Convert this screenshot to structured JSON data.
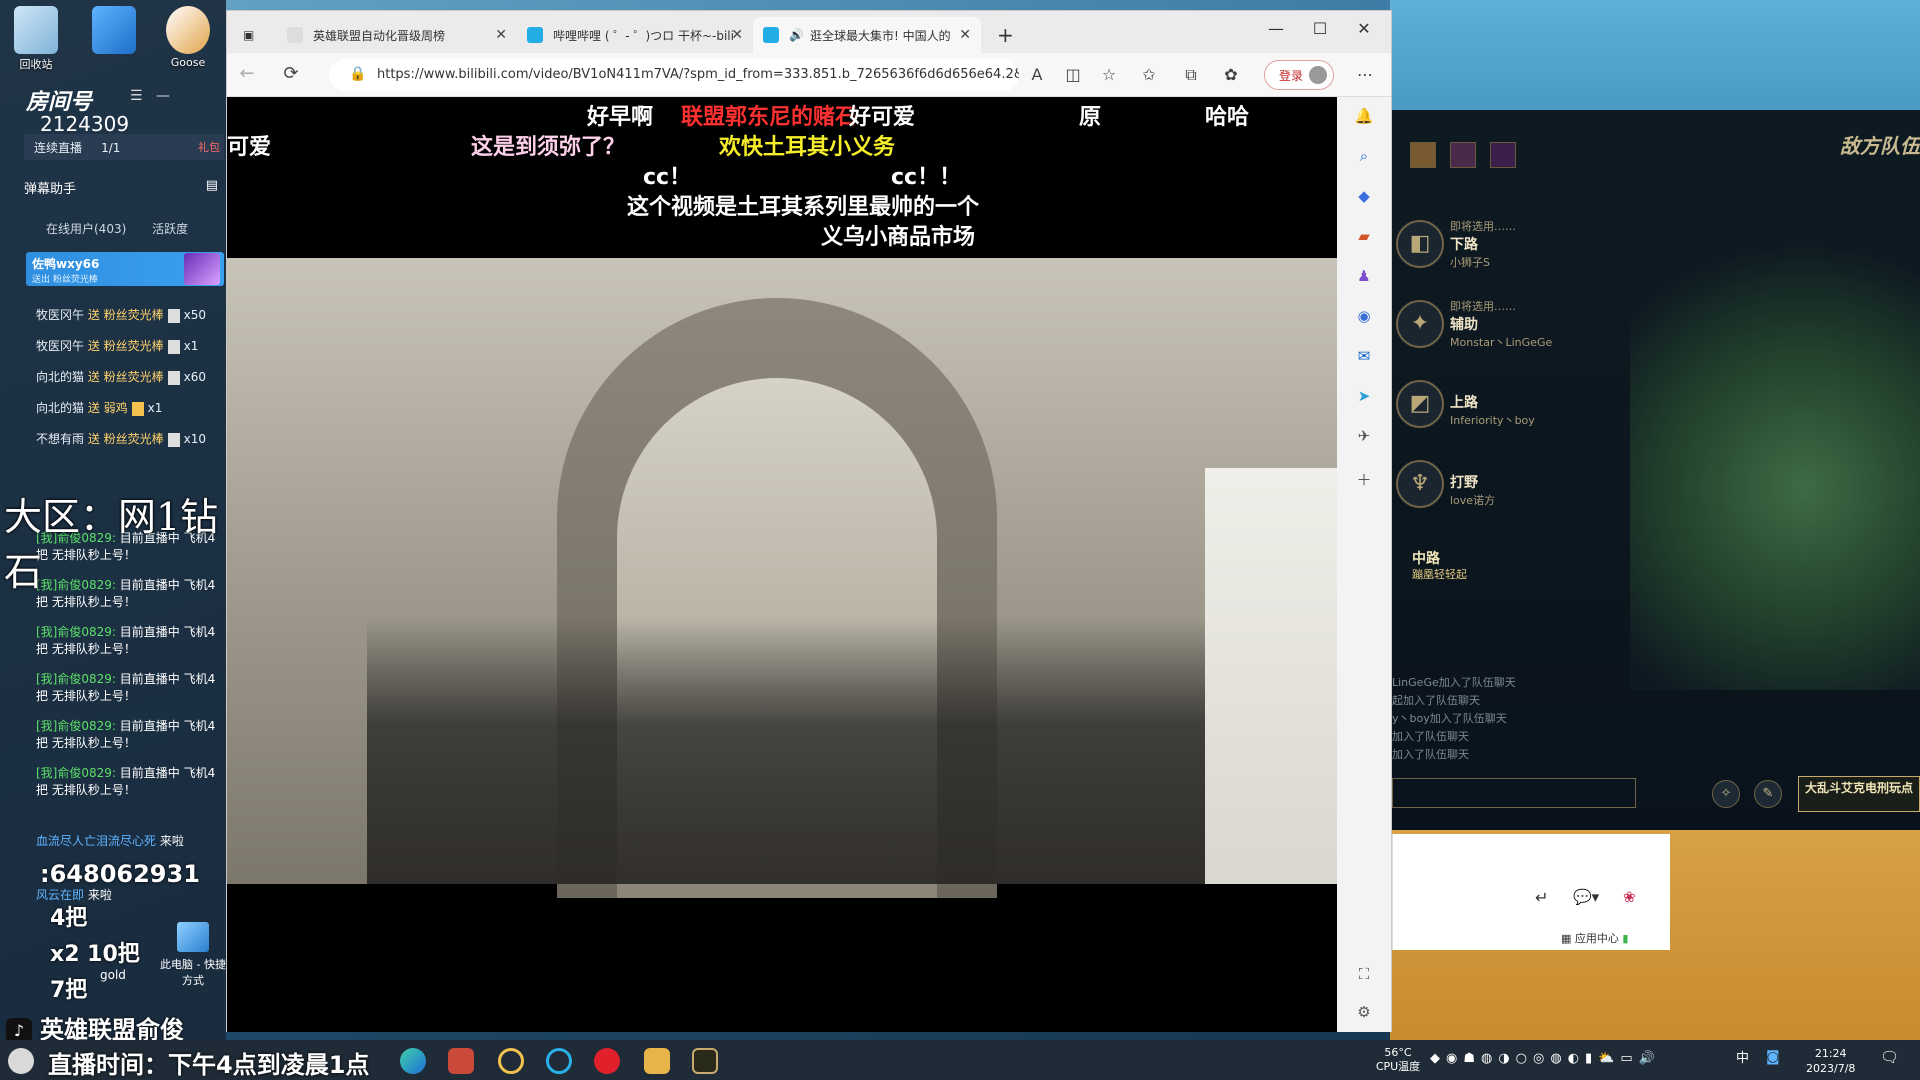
{
  "desktop": {
    "icons": [
      {
        "label": "回收站"
      },
      {
        "label": ""
      },
      {
        "label": "Goose"
      }
    ]
  },
  "stream_panel": {
    "room_label": "房间号",
    "room_id": "2124309",
    "stream_mode": "连续直播",
    "stream_count": "1/1",
    "gift_tag": "礼包",
    "assistant_title": "弹幕助手",
    "online_tab": "在线用户(403)",
    "activity_tab": "活跃度",
    "vip_user": "佐鸭wxy66",
    "vip_sub": "送出 粉丝荧光棒",
    "gifts": [
      {
        "user": "牧医冈午",
        "action": "送 粉丝荧光棒",
        "count": "x50"
      },
      {
        "user": "牧医冈午",
        "action": "送 粉丝荧光棒",
        "count": "x1"
      },
      {
        "user": "向北的猫",
        "action": "送 粉丝荧光棒",
        "count": "x60"
      },
      {
        "user": "向北的猫",
        "action": "送 弱鸡",
        "count": "x1"
      },
      {
        "user": "不想有雨",
        "action": "送 粉丝荧光棒",
        "count": "x10"
      }
    ],
    "server_label": "大区：网1钻石",
    "danmu": [
      {
        "user": "[我]俞俊0829:",
        "text": "目前直播中 飞机4把 无排队秒上号！"
      },
      {
        "user": "[我]俞俊0829:",
        "text": "目前直播中 飞机4把 无排队秒上号！"
      },
      {
        "user": "[我]俞俊0829:",
        "text": "目前直播中 飞机4把 无排队秒上号！"
      },
      {
        "user": "[我]俞俊0829:",
        "text": "目前直播中 飞机4把 无排队秒上号！"
      },
      {
        "user": "[我]俞俊0829:",
        "text": "目前直播中 飞机4把 无排队秒上号！"
      },
      {
        "user": "[我]俞俊0829:",
        "text": "目前直播中 飞机4把 无排队秒上号！"
      }
    ],
    "enter1_user": "血流尽人亡泪流尽心死",
    "enter1_action": "来啦",
    "enter2_user": "风云在即",
    "enter2_action": "来啦",
    "qq_number": ":648062931",
    "bet1": "4把",
    "bet2": "x2 10把",
    "bet3": "7把",
    "gold_label": "gold",
    "pc_icon_label": "此电脑 - 快捷方式",
    "douyin_label": "英雄联盟俞俊",
    "live_time": "直播时间：下午4点到凌晨1点"
  },
  "browser": {
    "tabs": [
      {
        "title": "英雄联盟自动化晋级周榜",
        "active": false
      },
      {
        "title": "哔哩哔哩 ( ゜- ゜)つロ 干杯~-bili",
        "active": false
      },
      {
        "title": "逛全球最大集市! 中国人的",
        "active": true
      }
    ],
    "new_tab": "+",
    "url": "https://www.bilibili.com/video/BV1oN411m7VA/?spm_id_from=333.851.b_7265636f6d6d656e64.2&...",
    "login_label": "登录",
    "danmaku": [
      {
        "text": "好早啊",
        "color": "white"
      },
      {
        "text": "联盟郭东尼的赌石",
        "color": "red"
      },
      {
        "text": "好可爱",
        "color": "white"
      },
      {
        "text": "原",
        "color": "white"
      },
      {
        "text": "哈哈",
        "color": "white"
      },
      {
        "text": "可爱",
        "color": "white"
      },
      {
        "text": "这是到须弥了？",
        "color": "pink"
      },
      {
        "text": "欢快土耳其小义务",
        "color": "yellow"
      },
      {
        "text": "cc！",
        "color": "white"
      },
      {
        "text": "cc！！",
        "color": "white"
      },
      {
        "text": "这个视频是土耳其系列里最帅的一个",
        "color": "white"
      },
      {
        "text": "义乌小商品市场",
        "color": "white"
      }
    ]
  },
  "game": {
    "enemy_label": "敌方队伍",
    "roles": [
      {
        "pre": "即将选用……",
        "role": "下路",
        "player": "小狮子S"
      },
      {
        "pre": "即将选用……",
        "role": "辅助",
        "player": "Monstar丶LinGeGe"
      },
      {
        "pre": "",
        "role": "上路",
        "player": "Inferiority丶boy"
      },
      {
        "pre": "",
        "role": "打野",
        "player": "love诺方"
      },
      {
        "pre": "",
        "role": "中路",
        "player": "蹦凰轻轻起"
      }
    ],
    "chat": [
      "LinGeGe加入了队伍聊天",
      "起加入了队伍聊天",
      "y丶boy加入了队伍聊天",
      "加入了队伍聊天",
      "加入了队伍聊天"
    ],
    "mode_button": "大乱斗艾克电刑玩点",
    "app_center": "应用中心"
  },
  "taskbar": {
    "cpu_temp": "56°C",
    "cpu_label": "CPU温度",
    "ime": "中",
    "time": "21:24",
    "date": "2023/7/8"
  }
}
